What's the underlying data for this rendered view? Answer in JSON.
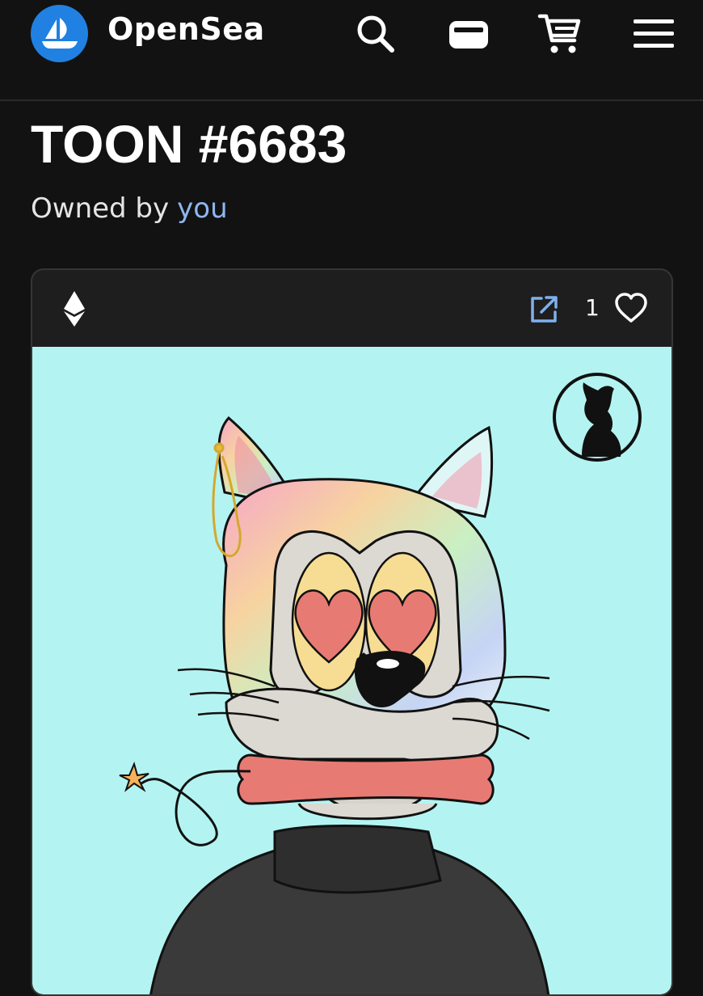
{
  "app": {
    "name": "OpenSea"
  },
  "header": {
    "icons": [
      "sailboat-logo-icon",
      "search-icon",
      "wallet-icon",
      "cart-icon",
      "menu-icon"
    ]
  },
  "item": {
    "title": "TOON #6683",
    "owned_by_label": "Owned by",
    "owner": "you",
    "chain_icon": "ethereum-icon",
    "like_count": "1"
  },
  "colors": {
    "background": "#121212",
    "brand_blue": "#2081e2",
    "owner_link": "#8fb6f0",
    "art_background": "#b3f4f2"
  }
}
